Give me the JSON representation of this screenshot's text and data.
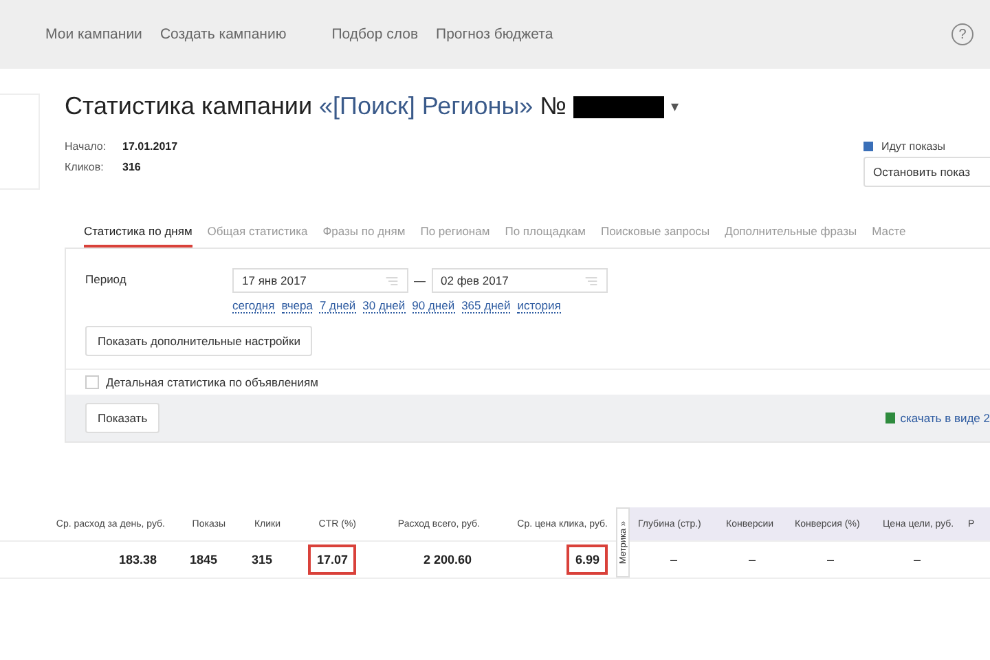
{
  "nav": {
    "items": [
      "Мои кампании",
      "Создать кампанию",
      "Подбор слов",
      "Прогноз бюджета"
    ],
    "help": "?"
  },
  "title": {
    "text": "Статистика кампании",
    "campaign": "«[Поиск] Регионы»",
    "number_sign": "№",
    "caret": "▾"
  },
  "info": [
    {
      "label": "Начало:",
      "value": "17.01.2017"
    },
    {
      "label": "Кликов:",
      "value": "316"
    }
  ],
  "status": {
    "text": "Идут показы",
    "button": "Остановить показ"
  },
  "tabs": [
    {
      "label": "Статистика по дням",
      "selected": true
    },
    {
      "label": "Общая статистика",
      "selected": false
    },
    {
      "label": "Фразы по дням",
      "selected": false
    },
    {
      "label": "По регионам",
      "selected": false
    },
    {
      "label": "По площадкам",
      "selected": false
    },
    {
      "label": "Поисковые запросы",
      "selected": false
    },
    {
      "label": "Дополнительные фразы",
      "selected": false
    },
    {
      "label": "Масте",
      "selected": false
    }
  ],
  "period": {
    "label": "Период",
    "from": "17 янв 2017",
    "dash": "—",
    "to": "02 фев 2017",
    "presets": [
      "сегодня",
      "вчера",
      "7 дней",
      "30 дней",
      "90 дней",
      "365 дней",
      "история"
    ]
  },
  "more_settings_button": "Показать дополнительные настройки",
  "detail_checkbox": {
    "label": "Детальная статистика по объявлениям",
    "checked": false
  },
  "show_button": "Показать",
  "download_link": "скачать в виде 2",
  "table": {
    "columns": [
      "Ср. расход за день, руб.",
      "Показы",
      "Клики",
      "CTR (%)",
      "Расход всего, руб.",
      "Ср. цена клика, руб."
    ],
    "row": [
      {
        "value": "183.38",
        "highlighted": false
      },
      {
        "value": "1845",
        "highlighted": false
      },
      {
        "value": "315",
        "highlighted": false
      },
      {
        "value": "17.07",
        "highlighted": true
      },
      {
        "value": "2 200.60",
        "highlighted": false
      },
      {
        "value": "6.99",
        "highlighted": true
      }
    ],
    "metrika_label": "Метрика »",
    "metrika_columns": [
      "Глубина (стр.)",
      "Конверсии",
      "Конверсия (%)",
      "Цена цели, руб.",
      "Р"
    ],
    "metrika_row": [
      "–",
      "–",
      "–",
      "–"
    ]
  }
}
